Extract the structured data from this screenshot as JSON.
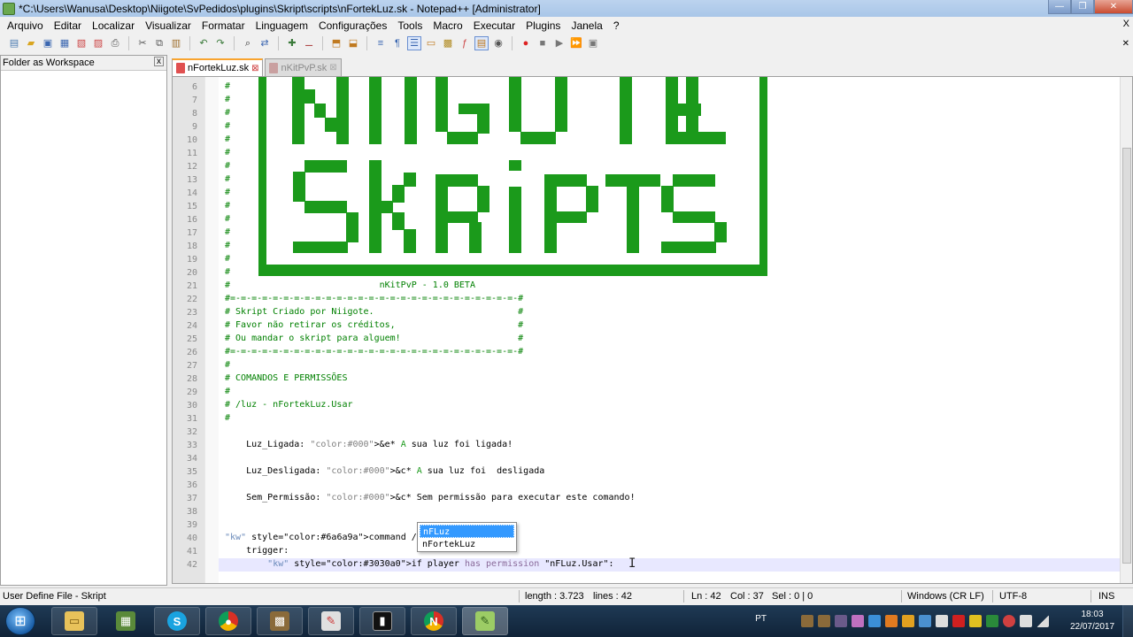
{
  "window": {
    "title": "*C:\\Users\\Wanusa\\Desktop\\Niigote\\SvPedidos\\plugins\\Skript\\scripts\\nFortekLuz.sk - Notepad++ [Administrator]"
  },
  "menu": [
    "Arquivo",
    "Editar",
    "Localizar",
    "Visualizar",
    "Formatar",
    "Linguagem",
    "Configurações",
    "Tools",
    "Macro",
    "Executar",
    "Plugins",
    "Janela",
    "?"
  ],
  "menu_close": "X",
  "left_panel": {
    "title": "Folder as Workspace",
    "close": "x"
  },
  "tabs": [
    {
      "label": "nFortekLuz.sk",
      "active": true
    },
    {
      "label": "nKitPvP.sk",
      "active": false
    }
  ],
  "editor": {
    "lines": [
      {
        "n": "6",
        "text": "#"
      },
      {
        "n": "7",
        "text": "#"
      },
      {
        "n": "8",
        "text": "#"
      },
      {
        "n": "9",
        "text": "#"
      },
      {
        "n": "10",
        "text": "#"
      },
      {
        "n": "11",
        "text": "#"
      },
      {
        "n": "12",
        "text": "#"
      },
      {
        "n": "13",
        "text": "#"
      },
      {
        "n": "14",
        "text": "#"
      },
      {
        "n": "15",
        "text": "#"
      },
      {
        "n": "16",
        "text": "#"
      },
      {
        "n": "17",
        "text": "#"
      },
      {
        "n": "18",
        "text": "#"
      },
      {
        "n": "19",
        "text": "#"
      },
      {
        "n": "20",
        "text": "#"
      },
      {
        "n": "21",
        "text": "#                            nKitPvP - 1.0 BETA"
      },
      {
        "n": "22",
        "text": "#=-=-=-=-=-=-=-=-=-=-=-=-=-=-=-=-=-=-=-=-=-=-=-=-=-=-=-#"
      },
      {
        "n": "23",
        "text": "# Skript Criado por Niigote.                           #"
      },
      {
        "n": "24",
        "text": "# Favor não retirar os créditos,                       #"
      },
      {
        "n": "25",
        "text": "# Ou mandar o skript para alguem!                      #"
      },
      {
        "n": "26",
        "text": "#=-=-=-=-=-=-=-=-=-=-=-=-=-=-=-=-=-=-=-=-=-=-=-=-=-=-=-#"
      },
      {
        "n": "27",
        "text": "#"
      },
      {
        "n": "28",
        "text": "# COMANDOS E PERMISSÕES"
      },
      {
        "n": "29",
        "text": "#"
      },
      {
        "n": "30",
        "text": "# /luz - nFortekLuz.Usar"
      },
      {
        "n": "31",
        "text": "#"
      },
      {
        "n": "32",
        "text": ""
      },
      {
        "n": "33",
        "text": "    Luz_Ligada: &e* A sua luz foi ligada!"
      },
      {
        "n": "34",
        "text": ""
      },
      {
        "n": "35",
        "text": "    Luz_Desligada: &c* A sua luz foi  desligada"
      },
      {
        "n": "36",
        "text": ""
      },
      {
        "n": "37",
        "text": "    Sem_Permissão: &c* Sem permissão para executar este comando!"
      },
      {
        "n": "38",
        "text": ""
      },
      {
        "n": "39",
        "text": ""
      },
      {
        "n": "40",
        "text": "command /luz:"
      },
      {
        "n": "41",
        "text": "    trigger:"
      },
      {
        "n": "42",
        "text": "        if player has permission \"nFLuz.Usar\":"
      }
    ]
  },
  "autocomplete": [
    "nFLuz",
    "nFortekLuz"
  ],
  "status": {
    "filetype": "User Define File - Skript",
    "length": "length : 3.723",
    "lines": "lines : 42",
    "ln": "Ln : 42",
    "col": "Col : 37",
    "sel": "Sel : 0 | 0",
    "eol": "Windows (CR LF)",
    "encoding": "UTF-8",
    "mode": "INS"
  },
  "taskbar": {
    "lang": "PT",
    "time": "18:03",
    "date": "22/07/2017",
    "apps": [
      "explorer-icon",
      "minecraft-icon",
      "skype-icon",
      "chrome-icon",
      "minecraft-block-icon",
      "paint-icon",
      "cmd-icon",
      "chrome-notepad-icon",
      "notepadpp-icon"
    ]
  },
  "colors": {
    "accent": "#f9a42f",
    "comment": "#008000",
    "banner": "#1b9a1b",
    "selection": "#3399ff"
  }
}
